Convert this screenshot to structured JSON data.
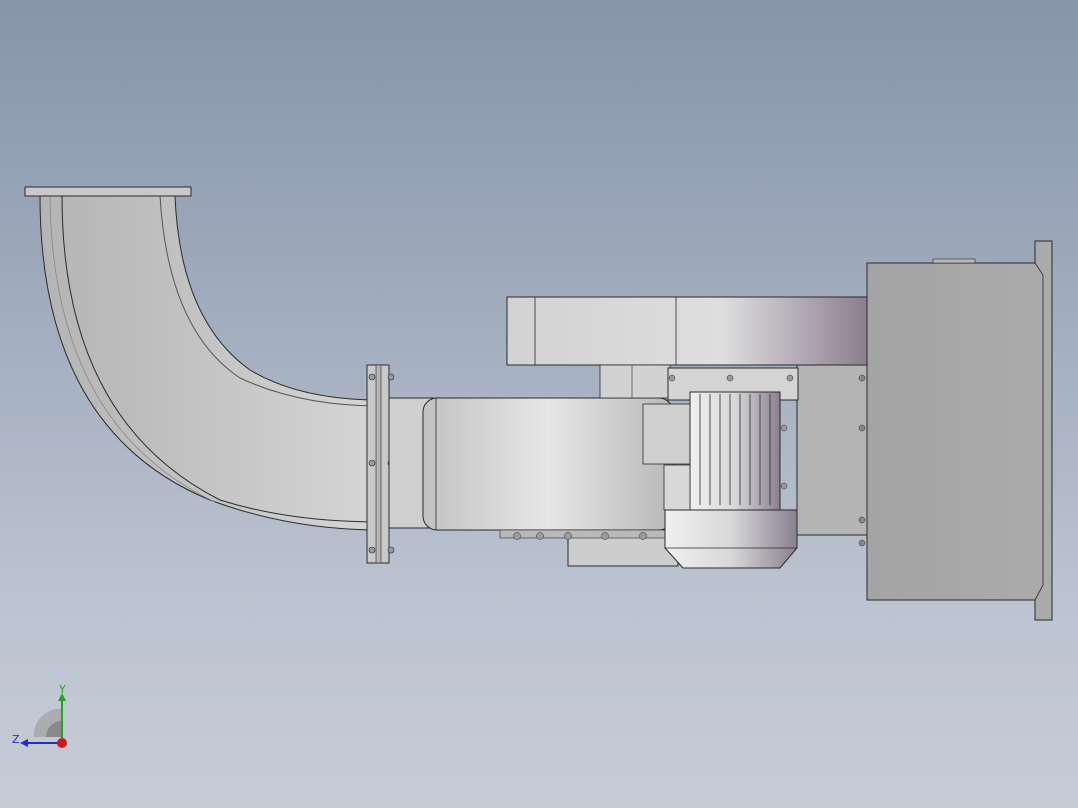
{
  "viewport": {
    "background_top": "#8794aa",
    "background_bottom": "#c6ccd6",
    "model_fill": "#cfcfcf",
    "model_dark": "#9a9a9a",
    "motor_fill": "#d8d8d8",
    "housing_fill": "#a8a8a8",
    "edge_color": "#2a2a2a"
  },
  "triad": {
    "y_label": "Y",
    "z_label": "Z",
    "y_color": "#1fa81f",
    "z_color": "#2030c8",
    "x_color": "#d01818"
  }
}
